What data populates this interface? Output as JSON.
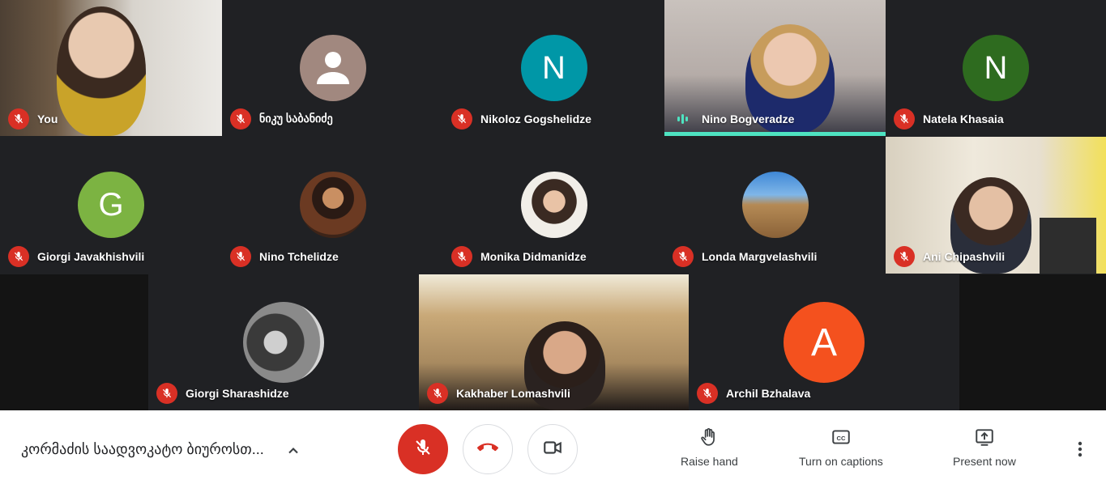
{
  "participants": [
    {
      "name": "You",
      "avatar_letter": "",
      "muted": true
    },
    {
      "name": "ნიკუ საბანიძე",
      "avatar_letter": "",
      "muted": true
    },
    {
      "name": "Nikoloz Gogshelidze",
      "avatar_letter": "N",
      "muted": true
    },
    {
      "name": "Nino Bogveradze",
      "avatar_letter": "",
      "muted": false,
      "speaking": true
    },
    {
      "name": "Natela Khasaia",
      "avatar_letter": "N",
      "muted": true
    },
    {
      "name": "Giorgi Javakhishvili",
      "avatar_letter": "G",
      "muted": true
    },
    {
      "name": "Nino Tchelidze",
      "avatar_letter": "",
      "muted": true
    },
    {
      "name": "Monika Didmanidze",
      "avatar_letter": "",
      "muted": true
    },
    {
      "name": "Londa Margvelashvili",
      "avatar_letter": "",
      "muted": true
    },
    {
      "name": "Ani Chipashvili",
      "avatar_letter": "",
      "muted": true
    },
    {
      "name": "Giorgi Sharashidze",
      "avatar_letter": "",
      "muted": true
    },
    {
      "name": "Kakhaber Lomashvili",
      "avatar_letter": "",
      "muted": true
    },
    {
      "name": "Archil Bzhalava",
      "avatar_letter": "A",
      "muted": true
    }
  ],
  "colors": {
    "nikoloz": "#0097a7",
    "natela": "#2e6b1f",
    "giorgi_j": "#7cb342",
    "archil": "#f4511e",
    "mute_red": "#d93025",
    "speaking": "#4ee3c1"
  },
  "bottom_bar": {
    "meeting_title": "კორმაძის საადვოკატო ბიუროსთ...",
    "actions": {
      "raise_hand": "Raise hand",
      "captions": "Turn on captions",
      "present": "Present now"
    }
  },
  "icons": [
    "mic-off-icon",
    "hang-up-icon",
    "camera-icon",
    "hand-icon",
    "captions-icon",
    "present-icon",
    "more-vert-icon",
    "chevron-up-icon",
    "person-placeholder-icon"
  ]
}
